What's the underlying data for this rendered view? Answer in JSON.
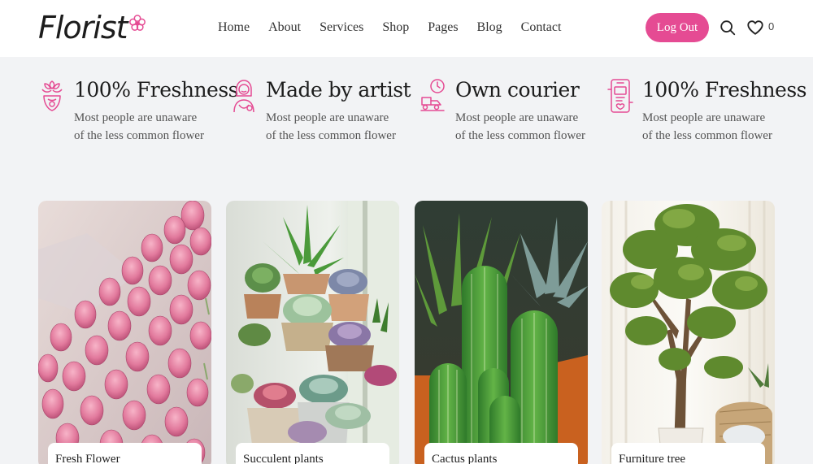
{
  "header": {
    "logo_text": "Florist",
    "nav": [
      "Home",
      "About",
      "Services",
      "Shop",
      "Pages",
      "Blog",
      "Contact"
    ],
    "logout_label": "Log Out",
    "wishlist_count": "0"
  },
  "features": [
    {
      "title": "100% Freshness",
      "desc": "Most people are unaware of the less common flower",
      "icon": "flower-bouquet-icon"
    },
    {
      "title": "Made by artist",
      "desc": "Most people are unaware of the less common flower",
      "icon": "florist-artist-icon"
    },
    {
      "title": "Own courier",
      "desc": "Most people are unaware of the less common flower",
      "icon": "courier-clock-icon"
    },
    {
      "title": "100% Freshness",
      "desc": "Most people are unaware of the less common flower",
      "icon": "mobile-order-icon"
    }
  ],
  "cards": [
    {
      "label": "Fresh Flower"
    },
    {
      "label": "Succulent plants"
    },
    {
      "label": "Cactus plants"
    },
    {
      "label": "Furniture tree"
    }
  ],
  "colors": {
    "accent": "#e54b93",
    "background": "#f2f3f5"
  }
}
